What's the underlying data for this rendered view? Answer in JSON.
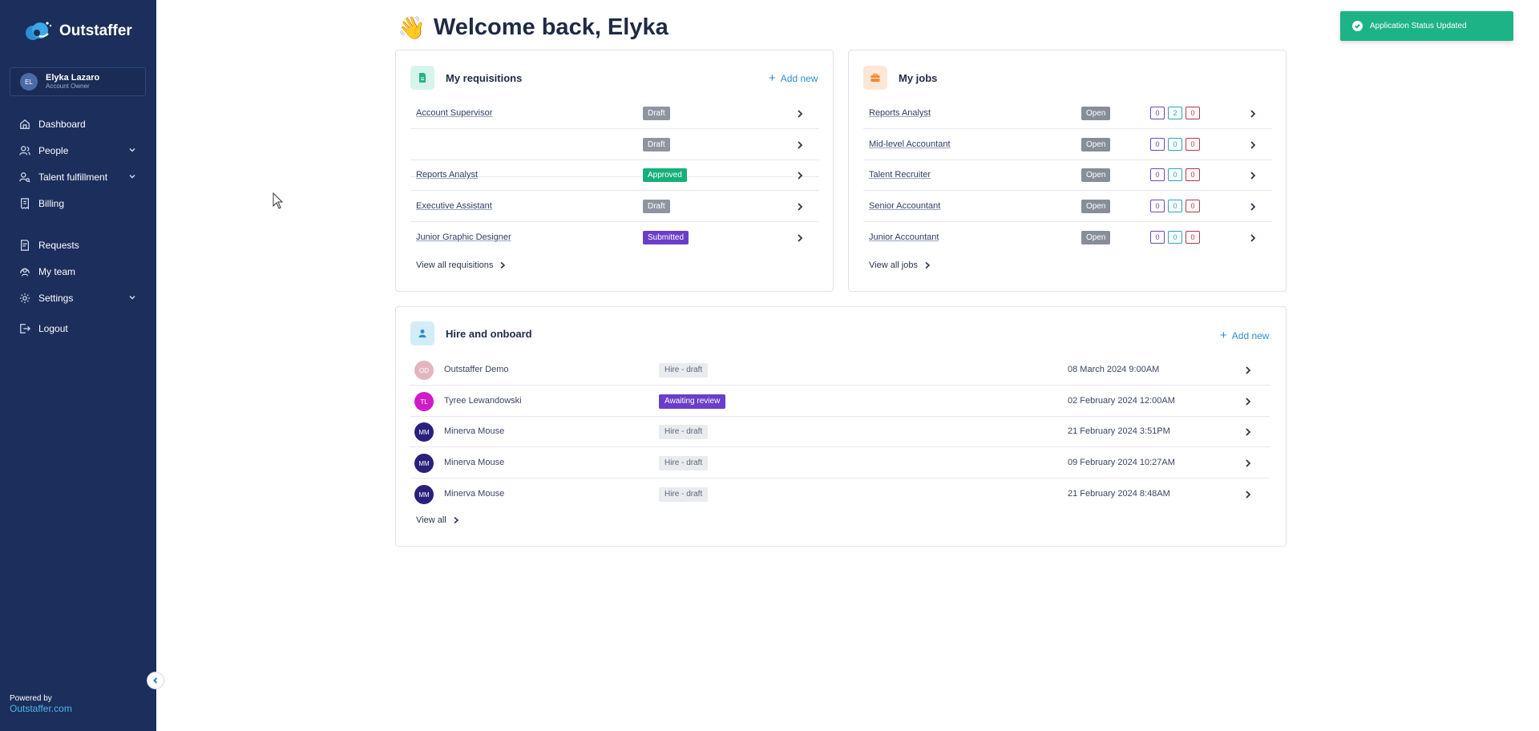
{
  "app": {
    "brand": "Outstaffer"
  },
  "user": {
    "initials": "EL",
    "name": "Elyka Lazaro",
    "role": "Account Owner"
  },
  "nav": {
    "dashboard": "Dashboard",
    "people": "People",
    "talent": "Talent fulfillment",
    "billing": "Billing",
    "requests": "Requests",
    "my_team": "My team",
    "settings": "Settings",
    "logout": "Logout"
  },
  "footer": {
    "powered_by": "Powered by",
    "link": "Outstaffer.com"
  },
  "header": {
    "wave": "👋",
    "title": "Welcome back, Elyka"
  },
  "toast": {
    "message": "Application Status Updated",
    "color": "#1eb386"
  },
  "requisitions": {
    "title": "My requisitions",
    "add_new": "Add new",
    "view_all": "View all requisitions",
    "items": [
      {
        "name": "Account Supervisor",
        "status": "Draft"
      },
      {
        "name": "",
        "status": "Draft"
      },
      {
        "name": "Reports Analyst",
        "status": "Approved"
      },
      {
        "name": "Executive Assistant",
        "status": "Draft"
      },
      {
        "name": "Junior Graphic Designer",
        "status": "Submitted"
      }
    ]
  },
  "jobs": {
    "title": "My jobs",
    "view_all": "View all jobs",
    "items": [
      {
        "name": "Reports Analyst",
        "status": "Open",
        "c1": "0",
        "c2": "2",
        "c3": "0"
      },
      {
        "name": "Mid-level Accountant",
        "status": "Open",
        "c1": "0",
        "c2": "0",
        "c3": "0"
      },
      {
        "name": "Talent Recruiter",
        "status": "Open",
        "c1": "0",
        "c2": "0",
        "c3": "0"
      },
      {
        "name": "Senior Accountant",
        "status": "Open",
        "c1": "0",
        "c2": "0",
        "c3": "0"
      },
      {
        "name": "Junior Accountant",
        "status": "Open",
        "c1": "0",
        "c2": "0",
        "c3": "0"
      }
    ]
  },
  "hire": {
    "title": "Hire and onboard",
    "add_new": "Add new",
    "view_all": "View all",
    "items": [
      {
        "initials": "OD",
        "name": "Outstaffer Demo",
        "status": "Hire - draft",
        "date": "08 March 2024 9:00AM"
      },
      {
        "initials": "TL",
        "name": "Tyree Lewandowski",
        "status": "Awaiting review",
        "date": "02 February 2024 12:00AM"
      },
      {
        "initials": "MM",
        "name": "Minerva Mouse",
        "status": "Hire - draft",
        "date": "21 February 2024 3:51PM"
      },
      {
        "initials": "MM",
        "name": "Minerva Mouse",
        "status": "Hire - draft",
        "date": "09 February 2024 10:27AM"
      },
      {
        "initials": "MM",
        "name": "Minerva Mouse",
        "status": "Hire - draft",
        "date": "21 February 2024 8:48AM"
      }
    ]
  }
}
